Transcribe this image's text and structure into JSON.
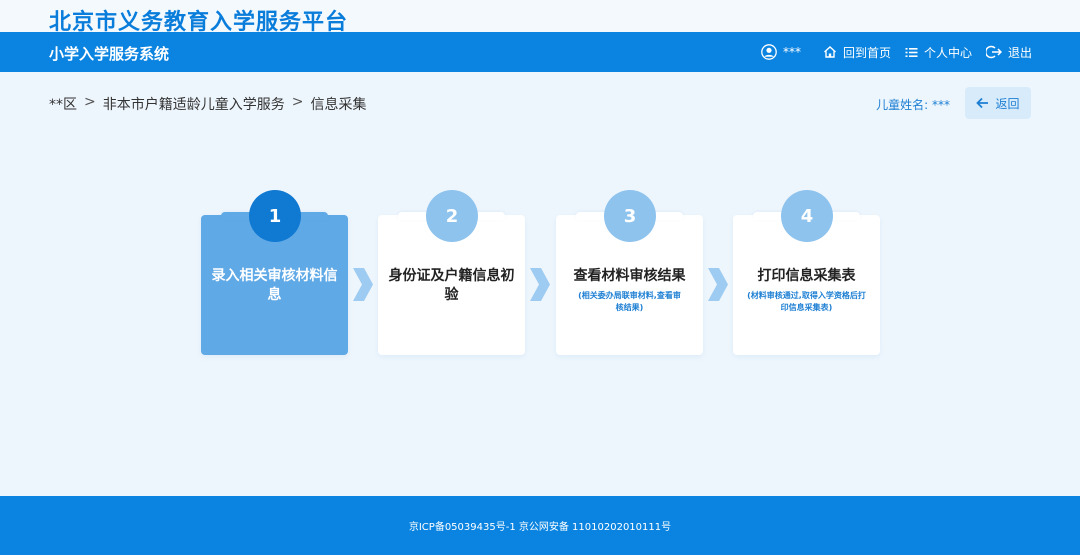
{
  "site": {
    "title": "北京市义务教育入学服务平台"
  },
  "navbar": {
    "system_name": "小学入学服务系统",
    "user_name": "***",
    "home_label": "回到首页",
    "personal_label": "个人中心",
    "logout_label": "退出"
  },
  "breadcrumb": {
    "items": [
      "**区",
      "非本市户籍适龄儿童入学服务",
      "信息采集"
    ],
    "separator": ">"
  },
  "child": {
    "label": "儿童姓名: ***"
  },
  "back_button": {
    "label": "返回"
  },
  "steps": [
    {
      "number": "1",
      "title": "录入相关审核材料信息",
      "subtitle": ""
    },
    {
      "number": "2",
      "title": "身份证及户籍信息初验",
      "subtitle": ""
    },
    {
      "number": "3",
      "title": "查看材料审核结果",
      "subtitle": "(相关委办局联审材料,查看审核结果)"
    },
    {
      "number": "4",
      "title": "打印信息采集表",
      "subtitle": "(材料审核通过,取得入学资格后打印信息采集表)"
    }
  ],
  "footer": {
    "text": "京ICP备05039435号-1 京公网安备 11010202010111号"
  },
  "colors": {
    "primary": "#0a84e0",
    "title_blue": "#0a7ddb",
    "active_step": "#5fa9e6",
    "inactive_circle": "#8ec3ee",
    "background": "#eef6fd"
  }
}
